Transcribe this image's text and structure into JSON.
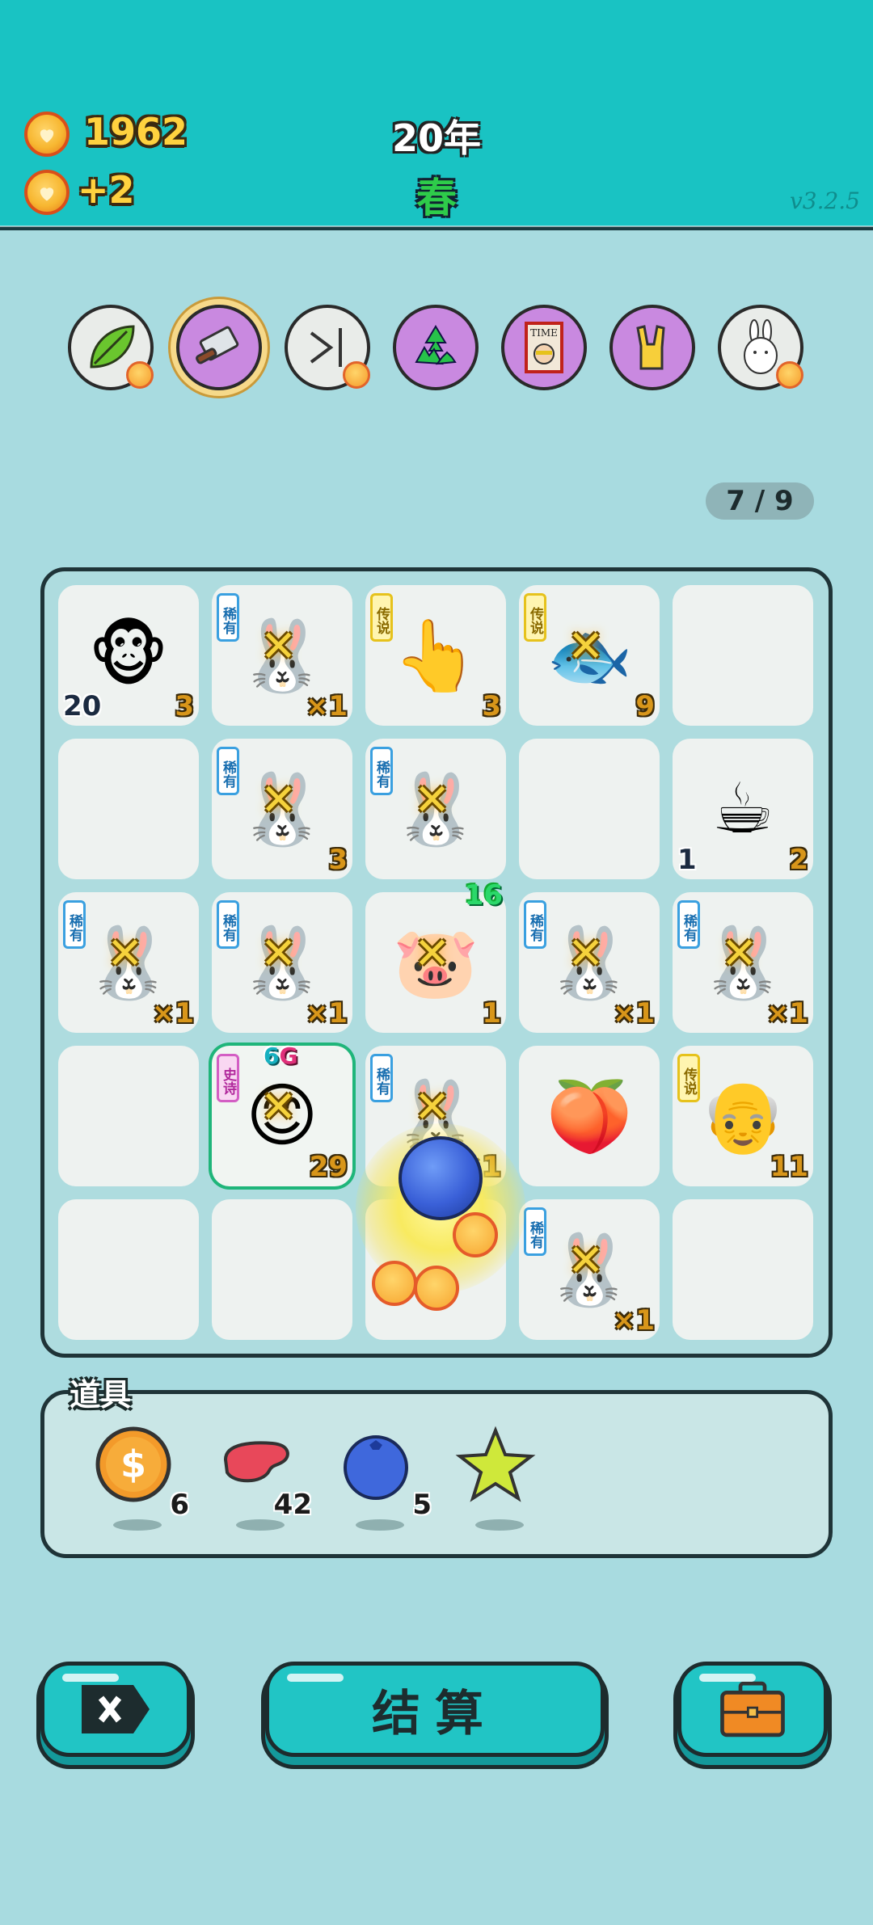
{
  "header": {
    "coins": "1962",
    "income": "+2",
    "year": "20年",
    "season": "春",
    "version": "v3.2.5"
  },
  "relics": [
    {
      "icon": "leaf-icon",
      "bg": "grey",
      "badge": true
    },
    {
      "icon": "cleaver-icon",
      "bg": "purple",
      "selected": true,
      "badge": false
    },
    {
      "icon": "skip-icon",
      "bg": "grey",
      "badge": true
    },
    {
      "icon": "recycle-icon",
      "bg": "purple",
      "badge": false
    },
    {
      "icon": "time-magazine-icon",
      "bg": "purple",
      "badge": false
    },
    {
      "icon": "rock-hand-icon",
      "bg": "purple",
      "badge": false
    },
    {
      "icon": "bunny-icon",
      "bg": "grey",
      "badge": true
    }
  ],
  "counter": "7 / 9",
  "board": {
    "rows": [
      [
        {
          "symbol": "monkey-with-glasses",
          "emoji": "🐵",
          "count_left": "20",
          "count_right": "3"
        },
        {
          "symbol": "bunny-rare",
          "emoji": "🐰",
          "tag": "稀有",
          "tag_type": "rare",
          "count_right": "×1",
          "crossed": true
        },
        {
          "symbol": "pointing-hand",
          "emoji": "👆",
          "tag": "传说",
          "tag_type": "leg",
          "count_right": "3"
        },
        {
          "symbol": "goldfish",
          "emoji": "🐟",
          "tag": "传说",
          "tag_type": "leg",
          "count_right": "9",
          "crossed": true
        },
        {
          "symbol": "empty"
        }
      ],
      [
        {
          "symbol": "empty"
        },
        {
          "symbol": "sleeping-bunny",
          "emoji": "🐰",
          "tag": "稀有",
          "tag_type": "rare",
          "count_right": "3",
          "crossed": true
        },
        {
          "symbol": "bunny-rare",
          "emoji": "🐰",
          "tag": "稀有",
          "tag_type": "rare",
          "crossed": true
        },
        {
          "symbol": "empty"
        },
        {
          "symbol": "coffee-cup",
          "emoji": "☕",
          "count_left": "1",
          "count_right": "2"
        }
      ],
      [
        {
          "symbol": "bunny-rare",
          "emoji": "🐰",
          "tag": "稀有",
          "tag_type": "rare",
          "count_right": "×1",
          "crossed": true
        },
        {
          "symbol": "bunny-rare",
          "emoji": "🐰",
          "tag": "稀有",
          "tag_type": "rare",
          "count_right": "×1",
          "crossed": true
        },
        {
          "symbol": "pig",
          "emoji": "🐷",
          "count_top": "16",
          "count_right": "1",
          "crossed": true
        },
        {
          "symbol": "bunny-rare",
          "emoji": "🐰",
          "tag": "稀有",
          "tag_type": "rare",
          "count_right": "×1",
          "crossed": true
        },
        {
          "symbol": "bunny-rare",
          "emoji": "🐰",
          "tag": "稀有",
          "tag_type": "rare",
          "count_right": "×1",
          "crossed": true
        }
      ],
      [
        {
          "symbol": "empty"
        },
        {
          "symbol": "boy-red-hat",
          "emoji": "😊",
          "tag": "史诗",
          "tag_type": "epic",
          "count_right": "29",
          "highlight": true,
          "gg6": "6",
          "ggG": "G",
          "crossed": true
        },
        {
          "symbol": "bunny-rare",
          "emoji": "🐰",
          "tag": "稀有",
          "tag_type": "rare",
          "count_right": "×1",
          "crossed": true
        },
        {
          "symbol": "peach",
          "emoji": "🍑"
        },
        {
          "symbol": "old-man-glasses",
          "emoji": "👴",
          "tag": "传说",
          "tag_type": "leg",
          "count_right": "11"
        }
      ],
      [
        {
          "symbol": "empty"
        },
        {
          "symbol": "empty"
        },
        {
          "symbol": "coin-burst",
          "emoji": ""
        },
        {
          "symbol": "bunny-rare",
          "emoji": "🐰",
          "tag": "稀有",
          "tag_type": "rare",
          "count_right": "×1",
          "crossed": true
        },
        {
          "symbol": "empty"
        }
      ]
    ]
  },
  "items": {
    "label": "道具",
    "list": [
      {
        "icon": "dollar-coin-icon",
        "qty": "6"
      },
      {
        "icon": "liver-icon",
        "qty": "42"
      },
      {
        "icon": "blueberry-icon",
        "qty": "5"
      },
      {
        "icon": "star-icon",
        "qty": ""
      }
    ]
  },
  "buttons": {
    "settle_label": "结算"
  }
}
